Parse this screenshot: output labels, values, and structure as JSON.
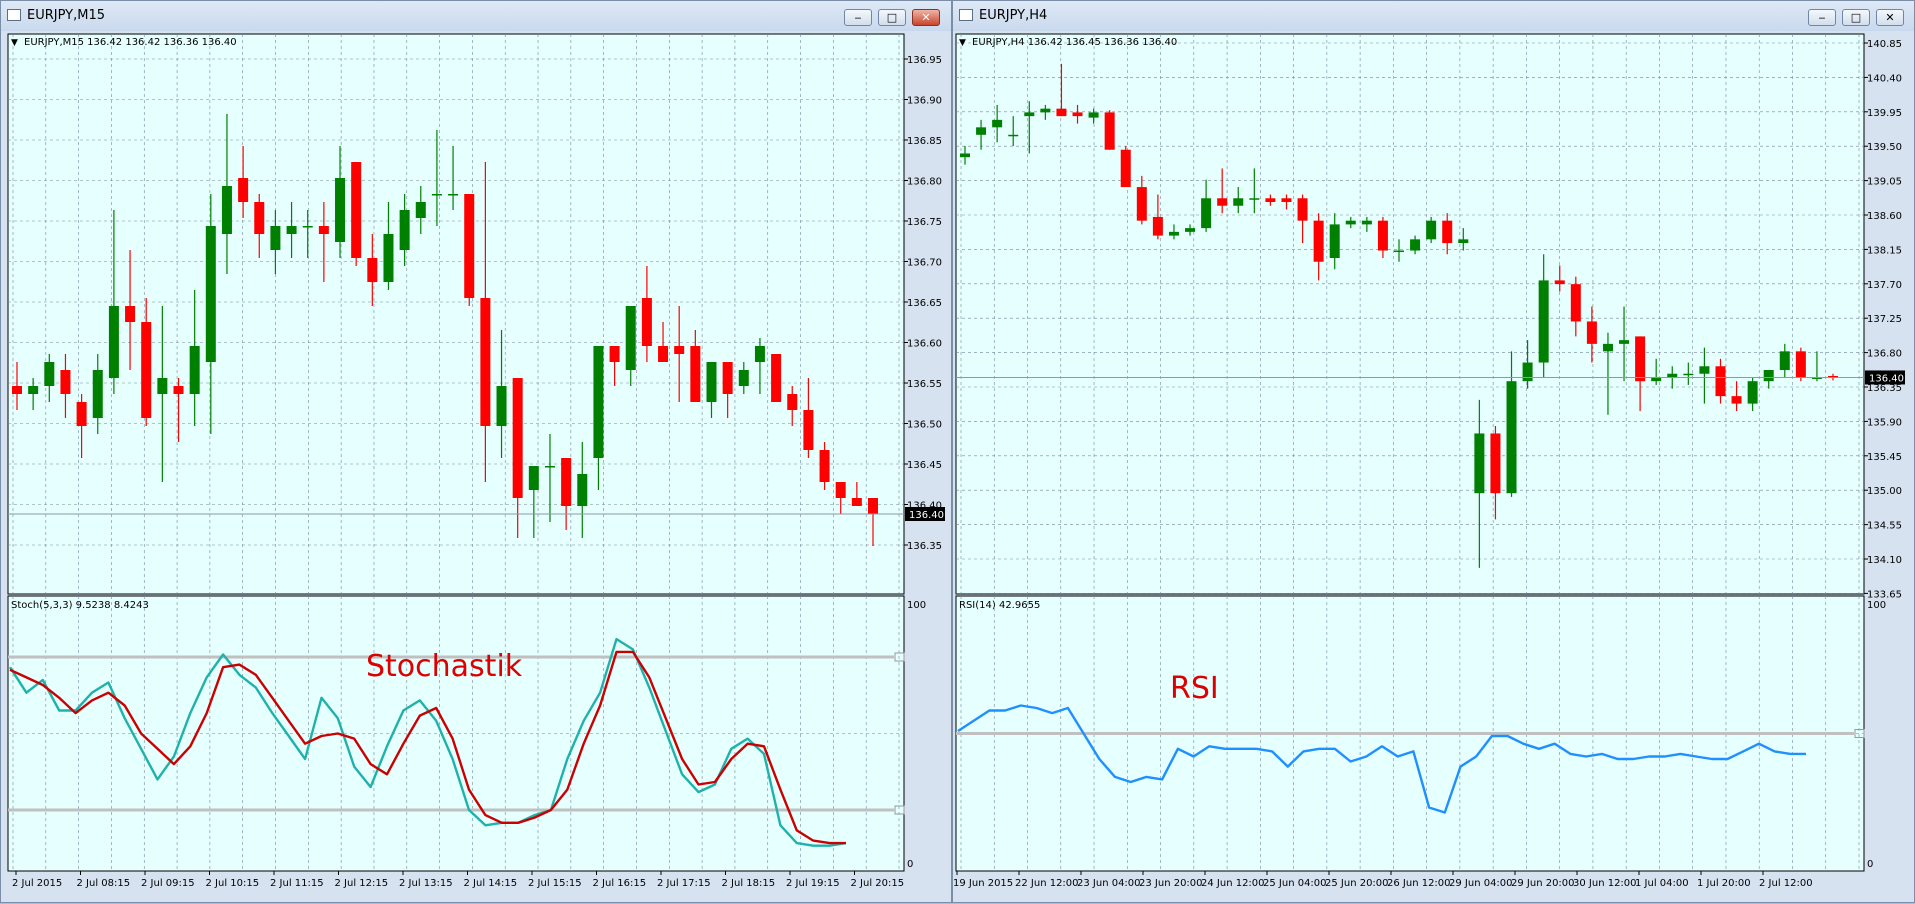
{
  "windows": [
    {
      "title": "EURJPY,M15",
      "header": "EURJPY,M15  136.42 136.42 136.36 136.40",
      "price_label": "136.40",
      "indicator_header": "Stoch(5,3,3) 9.5238 8.4243",
      "annotation": "Stochastik",
      "buttons": {
        "minimize": "‒",
        "maximize": "□",
        "close": "✕"
      }
    },
    {
      "title": "EURJPY,H4",
      "header": "EURJPY,H4  136.42 136.45 136.36 136.40",
      "price_label": "136.40",
      "indicator_header": "RSI(14) 42.9655",
      "annotation": "RSI",
      "buttons": {
        "minimize": "‒",
        "maximize": "□",
        "close": "✕"
      }
    }
  ],
  "colors": {
    "bull": "#008000",
    "bear": "#ff0000",
    "background": "#e6ffff",
    "grid": "#778899",
    "stoch_main": "#20b2aa",
    "stoch_signal": "#cc0000",
    "rsi": "#1e90ff",
    "level": "#c0c0c0",
    "annotation": "#dd0000"
  },
  "chart_data": [
    {
      "type": "candlestick",
      "symbol": "EURJPY",
      "timeframe": "M15",
      "ylim": [
        136.3,
        137.0
      ],
      "y_ticks": [
        "136.95",
        "136.90",
        "136.85",
        "136.80",
        "136.75",
        "136.70",
        "136.65",
        "136.60",
        "136.55",
        "136.50",
        "136.45",
        "136.40",
        "136.35"
      ],
      "x_ticks": [
        "2 Jul 2015",
        "2 Jul 08:15",
        "2 Jul 09:15",
        "2 Jul 10:15",
        "2 Jul 11:15",
        "2 Jul 12:15",
        "2 Jul 13:15",
        "2 Jul 14:15",
        "2 Jul 15:15",
        "2 Jul 16:15",
        "2 Jul 17:15",
        "2 Jul 18:15",
        "2 Jul 19:15",
        "2 Jul 20:15"
      ],
      "last_price": 136.4,
      "ohlc": [
        [
          136.56,
          136.59,
          136.53,
          136.55
        ],
        [
          136.55,
          136.57,
          136.53,
          136.56
        ],
        [
          136.56,
          136.6,
          136.54,
          136.59
        ],
        [
          136.58,
          136.6,
          136.52,
          136.55
        ],
        [
          136.54,
          136.55,
          136.47,
          136.51
        ],
        [
          136.52,
          136.6,
          136.5,
          136.58
        ],
        [
          136.57,
          136.78,
          136.55,
          136.66
        ],
        [
          136.66,
          136.73,
          136.58,
          136.64
        ],
        [
          136.64,
          136.67,
          136.51,
          136.52
        ],
        [
          136.55,
          136.66,
          136.44,
          136.57
        ],
        [
          136.56,
          136.57,
          136.49,
          136.55
        ],
        [
          136.55,
          136.68,
          136.51,
          136.61
        ],
        [
          136.59,
          136.8,
          136.5,
          136.76
        ],
        [
          136.75,
          136.9,
          136.7,
          136.81
        ],
        [
          136.82,
          136.86,
          136.77,
          136.79
        ],
        [
          136.79,
          136.8,
          136.72,
          136.75
        ],
        [
          136.73,
          136.78,
          136.7,
          136.76
        ],
        [
          136.75,
          136.79,
          136.72,
          136.76
        ],
        [
          136.76,
          136.78,
          136.72,
          136.76
        ],
        [
          136.76,
          136.79,
          136.69,
          136.75
        ],
        [
          136.74,
          136.86,
          136.72,
          136.82
        ],
        [
          136.84,
          136.84,
          136.71,
          136.72
        ],
        [
          136.72,
          136.75,
          136.66,
          136.69
        ],
        [
          136.69,
          136.79,
          136.68,
          136.75
        ],
        [
          136.73,
          136.8,
          136.71,
          136.78
        ],
        [
          136.77,
          136.81,
          136.75,
          136.79
        ],
        [
          136.8,
          136.88,
          136.76,
          136.8
        ],
        [
          136.8,
          136.86,
          136.78,
          136.8
        ],
        [
          136.8,
          136.8,
          136.66,
          136.67
        ],
        [
          136.67,
          136.84,
          136.44,
          136.51
        ],
        [
          136.51,
          136.63,
          136.47,
          136.56
        ],
        [
          136.57,
          136.57,
          136.37,
          136.42
        ],
        [
          136.43,
          136.46,
          136.37,
          136.46
        ],
        [
          136.46,
          136.5,
          136.39,
          136.46
        ],
        [
          136.47,
          136.47,
          136.38,
          136.41
        ],
        [
          136.41,
          136.49,
          136.37,
          136.45
        ],
        [
          136.47,
          136.6,
          136.43,
          136.61
        ],
        [
          136.61,
          136.61,
          136.56,
          136.59
        ],
        [
          136.58,
          136.65,
          136.56,
          136.66
        ],
        [
          136.67,
          136.71,
          136.59,
          136.61
        ],
        [
          136.61,
          136.64,
          136.59,
          136.59
        ],
        [
          136.61,
          136.66,
          136.54,
          136.6
        ],
        [
          136.61,
          136.63,
          136.54,
          136.54
        ],
        [
          136.54,
          136.56,
          136.52,
          136.59
        ],
        [
          136.59,
          136.59,
          136.52,
          136.55
        ],
        [
          136.56,
          136.59,
          136.55,
          136.58
        ],
        [
          136.59,
          136.62,
          136.55,
          136.61
        ],
        [
          136.6,
          136.6,
          136.54,
          136.54
        ],
        [
          136.55,
          136.56,
          136.51,
          136.53
        ],
        [
          136.53,
          136.57,
          136.47,
          136.48
        ],
        [
          136.48,
          136.49,
          136.43,
          136.44
        ],
        [
          136.44,
          136.44,
          136.4,
          136.42
        ],
        [
          136.42,
          136.44,
          136.41,
          136.41
        ],
        [
          136.42,
          136.42,
          136.36,
          136.4
        ]
      ],
      "indicator": {
        "name": "Stoch(5,3,3)",
        "main_value": 9.5238,
        "signal_value": 8.4243,
        "ylim": [
          0,
          100
        ],
        "y_ticks": [
          "100",
          "0"
        ],
        "levels": [
          80,
          20
        ],
        "main": [
          76,
          66,
          71,
          59,
          59,
          66,
          70,
          56,
          44,
          32,
          41,
          58,
          72,
          81,
          73,
          68,
          58,
          49,
          40,
          64,
          56,
          37,
          29,
          45,
          59,
          63,
          55,
          40,
          20,
          14,
          15,
          15,
          18,
          20,
          40,
          55,
          66,
          87,
          83,
          68,
          51,
          34,
          27,
          30,
          44,
          48,
          42,
          14,
          7,
          6,
          6,
          7
        ],
        "signal": [
          75,
          72,
          69,
          64,
          58,
          63,
          66,
          61,
          50,
          44,
          38,
          45,
          58,
          76,
          77,
          73,
          64,
          55,
          46,
          49,
          50,
          48,
          38,
          34,
          46,
          57,
          60,
          48,
          28,
          18,
          15,
          15,
          17,
          20,
          28,
          46,
          61,
          82,
          82,
          72,
          56,
          40,
          30,
          31,
          40,
          46,
          45,
          28,
          12,
          8,
          7,
          7
        ]
      }
    },
    {
      "type": "candlestick",
      "symbol": "EURJPY",
      "timeframe": "H4",
      "ylim": [
        133.5,
        141.0
      ],
      "y_ticks": [
        "140.85",
        "140.40",
        "139.95",
        "139.50",
        "139.05",
        "138.60",
        "138.15",
        "137.70",
        "137.25",
        "136.80",
        "136.35",
        "135.90",
        "135.45",
        "135.00",
        "134.55",
        "134.10",
        "133.65"
      ],
      "x_ticks": [
        "19 Jun 2015",
        "22 Jun 12:00",
        "23 Jun 04:00",
        "23 Jun 20:00",
        "24 Jun 12:00",
        "25 Jun 04:00",
        "25 Jun 20:00",
        "26 Jun 12:00",
        "29 Jun 04:00",
        "29 Jun 20:00",
        "30 Jun 12:00",
        "1 Jul 04:00",
        "1 Jul 20:00",
        "2 Jul 12:00"
      ],
      "last_price": 136.4,
      "ohlc": [
        [
          139.35,
          139.5,
          139.25,
          139.4
        ],
        [
          139.65,
          139.85,
          139.45,
          139.75
        ],
        [
          139.75,
          140.05,
          139.55,
          139.85
        ],
        [
          139.65,
          139.9,
          139.5,
          139.65
        ],
        [
          139.9,
          140.1,
          139.4,
          139.95
        ],
        [
          139.95,
          140.05,
          139.85,
          140.0
        ],
        [
          140.0,
          140.6,
          139.9,
          139.9
        ],
        [
          139.95,
          140.05,
          139.8,
          139.9
        ],
        [
          139.88,
          140.0,
          139.8,
          139.95
        ],
        [
          139.95,
          139.98,
          139.45,
          139.45
        ],
        [
          139.45,
          139.5,
          139.0,
          138.95
        ],
        [
          138.95,
          139.1,
          138.45,
          138.5
        ],
        [
          138.55,
          138.85,
          138.25,
          138.3
        ],
        [
          138.3,
          138.45,
          138.25,
          138.35
        ],
        [
          138.35,
          138.45,
          138.3,
          138.4
        ],
        [
          138.4,
          139.05,
          138.35,
          138.8
        ],
        [
          138.8,
          139.2,
          138.6,
          138.7
        ],
        [
          138.7,
          138.95,
          138.6,
          138.8
        ],
        [
          138.8,
          139.2,
          138.6,
          138.8
        ],
        [
          138.8,
          138.85,
          138.7,
          138.75
        ],
        [
          138.8,
          138.85,
          138.65,
          138.75
        ],
        [
          138.8,
          138.85,
          138.2,
          138.5
        ],
        [
          138.5,
          138.6,
          137.7,
          137.95
        ],
        [
          138.0,
          138.6,
          137.85,
          138.45
        ],
        [
          138.45,
          138.55,
          138.4,
          138.5
        ],
        [
          138.45,
          138.55,
          138.35,
          138.5
        ],
        [
          138.5,
          138.55,
          138.0,
          138.1
        ],
        [
          138.1,
          138.25,
          137.95,
          138.1
        ],
        [
          138.1,
          138.3,
          138.05,
          138.25
        ],
        [
          138.25,
          138.55,
          138.2,
          138.5
        ],
        [
          138.5,
          138.6,
          138.05,
          138.2
        ],
        [
          138.2,
          138.4,
          138.1,
          138.25
        ],
        [
          134.85,
          136.1,
          133.85,
          135.65
        ],
        [
          135.65,
          135.75,
          134.5,
          134.85
        ],
        [
          134.85,
          136.75,
          134.8,
          136.35
        ],
        [
          136.35,
          136.9,
          136.25,
          136.6
        ],
        [
          136.6,
          138.05,
          136.4,
          137.7
        ],
        [
          137.7,
          137.9,
          137.55,
          137.65
        ],
        [
          137.65,
          137.75,
          136.95,
          137.15
        ],
        [
          137.15,
          137.35,
          136.6,
          136.85
        ],
        [
          136.75,
          137.0,
          135.9,
          136.85
        ],
        [
          136.85,
          137.35,
          136.35,
          136.9
        ],
        [
          136.95,
          136.95,
          135.95,
          136.35
        ],
        [
          136.35,
          136.65,
          136.3,
          136.4
        ],
        [
          136.4,
          136.55,
          136.25,
          136.45
        ],
        [
          136.45,
          136.6,
          136.3,
          136.45
        ],
        [
          136.45,
          136.8,
          136.05,
          136.55
        ],
        [
          136.55,
          136.65,
          136.05,
          136.15
        ],
        [
          136.15,
          136.35,
          135.95,
          136.05
        ],
        [
          136.05,
          136.4,
          135.95,
          136.35
        ],
        [
          136.35,
          136.5,
          136.25,
          136.5
        ],
        [
          136.5,
          136.85,
          136.4,
          136.75
        ],
        [
          136.75,
          136.8,
          136.35,
          136.4
        ],
        [
          136.4,
          136.75,
          136.35,
          136.4
        ],
        [
          136.42,
          136.45,
          136.36,
          136.4
        ]
      ],
      "indicator": {
        "name": "RSI(14)",
        "value": 42.9655,
        "ylim": [
          0,
          100
        ],
        "y_ticks": [
          "100",
          "0"
        ],
        "levels": [
          50
        ],
        "values": [
          51,
          55,
          59,
          59,
          61,
          60,
          58,
          60,
          50,
          40,
          33,
          31,
          33,
          32,
          44,
          41,
          45,
          44,
          44,
          44,
          43,
          37,
          43,
          44,
          44,
          39,
          41,
          45,
          41,
          43,
          21,
          19,
          37,
          41,
          49,
          49,
          46,
          44,
          46,
          42,
          41,
          42,
          40,
          40,
          41,
          41,
          42,
          41,
          40,
          40,
          43,
          46,
          43,
          42,
          42
        ]
      }
    }
  ]
}
